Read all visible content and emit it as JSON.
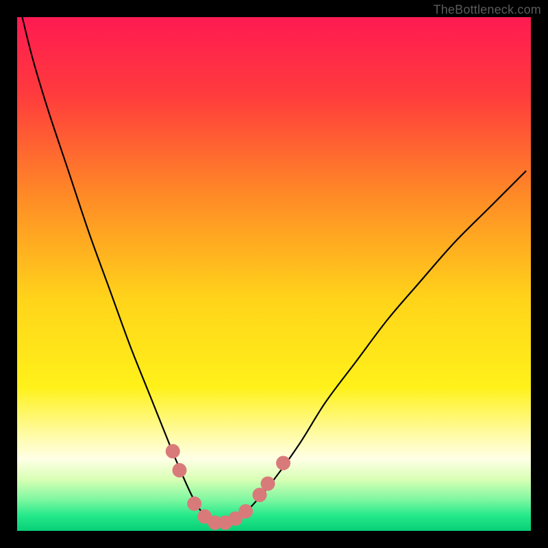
{
  "watermark": "TheBottleneck.com",
  "chart_data": {
    "type": "line",
    "title": "",
    "xlabel": "",
    "ylabel": "",
    "xlim": [
      0,
      100
    ],
    "ylim": [
      0,
      100
    ],
    "background": {
      "kind": "vertical-gradient",
      "stops": [
        {
          "t": 0.0,
          "color": "#ff1a52"
        },
        {
          "t": 0.15,
          "color": "#ff3b3d"
        },
        {
          "t": 0.35,
          "color": "#ff8b26"
        },
        {
          "t": 0.55,
          "color": "#ffd41a"
        },
        {
          "t": 0.72,
          "color": "#fff11a"
        },
        {
          "t": 0.82,
          "color": "#fffcb0"
        },
        {
          "t": 0.86,
          "color": "#ffffe6"
        },
        {
          "t": 0.9,
          "color": "#d8ffb4"
        },
        {
          "t": 0.94,
          "color": "#7cf7a0"
        },
        {
          "t": 0.97,
          "color": "#25e98a"
        },
        {
          "t": 1.0,
          "color": "#08cf77"
        }
      ]
    },
    "series": [
      {
        "name": "bottleneck-curve",
        "x": [
          1,
          3,
          6,
          10,
          14,
          18,
          22,
          26,
          30,
          33,
          35,
          37,
          38.5,
          40,
          42,
          44,
          46,
          50,
          55,
          60,
          66,
          72,
          78,
          85,
          92,
          99
        ],
        "y": [
          100,
          92,
          82,
          70,
          58,
          47,
          36,
          26,
          16,
          9,
          5,
          2.5,
          1.6,
          1.5,
          2.2,
          3.4,
          5.2,
          10,
          17,
          25,
          33,
          41,
          48,
          56,
          63,
          70
        ]
      }
    ],
    "marker_points": {
      "name": "threshold-band-markers",
      "color": "#d97a7a",
      "points": [
        {
          "x": 30.3,
          "y": 15.5
        },
        {
          "x": 31.6,
          "y": 11.8
        },
        {
          "x": 34.5,
          "y": 5.3
        },
        {
          "x": 36.5,
          "y": 2.8
        },
        {
          "x": 38.5,
          "y": 1.6
        },
        {
          "x": 40.5,
          "y": 1.6
        },
        {
          "x": 42.5,
          "y": 2.4
        },
        {
          "x": 44.5,
          "y": 3.8
        },
        {
          "x": 47.2,
          "y": 7.0
        },
        {
          "x": 48.8,
          "y": 9.2
        },
        {
          "x": 51.8,
          "y": 13.2
        }
      ]
    },
    "curve_min": {
      "x": 39.5,
      "y": 1.5
    }
  }
}
